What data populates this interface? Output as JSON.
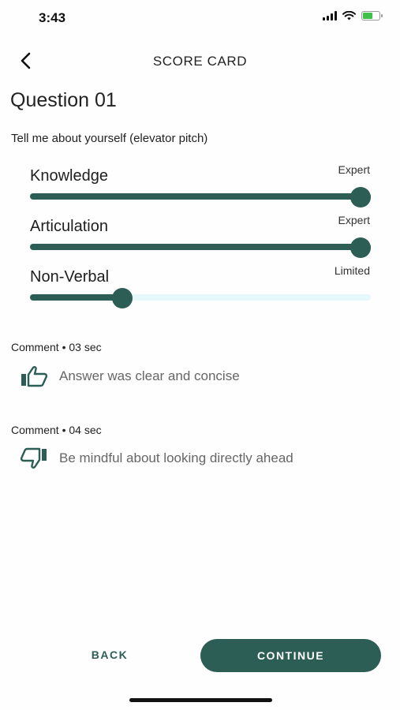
{
  "status_bar": {
    "time": "3:43",
    "icons": [
      "signal-icon",
      "wifi-icon",
      "battery-icon"
    ]
  },
  "header": {
    "title": "SCORE CARD",
    "back_icon": "chevron-left-icon"
  },
  "question": {
    "title": "Question 01",
    "text": "Tell me about yourself (elevator pitch)"
  },
  "metrics": [
    {
      "name": "Knowledge",
      "level": "Expert",
      "value": 1.0
    },
    {
      "name": "Articulation",
      "level": "Expert",
      "value": 1.0
    },
    {
      "name": "Non-Verbal",
      "level": "Limited",
      "value": 0.27
    }
  ],
  "comments": [
    {
      "label": "Comment",
      "time": "03 sec",
      "icon": "thumbs-up-icon",
      "text": "Answer was clear and concise"
    },
    {
      "label": "Comment",
      "time": "04 sec",
      "icon": "thumbs-down-icon",
      "text": "Be mindful about looking directly ahead"
    }
  ],
  "footer": {
    "back_label": "BACK",
    "continue_label": "CONTINUE"
  },
  "colors": {
    "accent": "#2c5e55",
    "track": "#e6f8fb",
    "battery": "#3fc24a"
  }
}
